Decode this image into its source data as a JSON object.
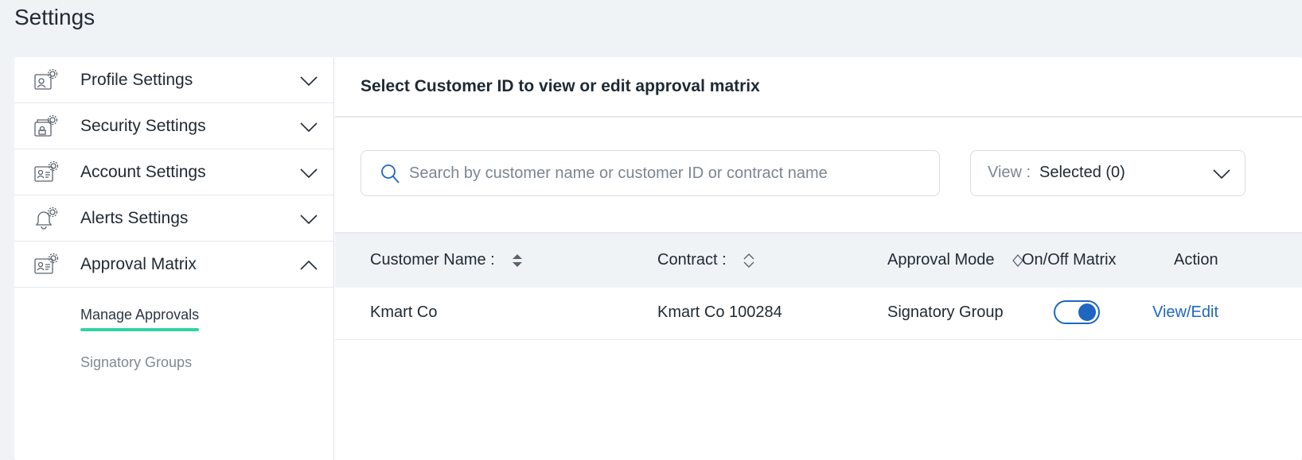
{
  "page": {
    "title": "Settings"
  },
  "sidebar": {
    "items": [
      {
        "label": "Profile Settings",
        "icon": "profile-settings-icon",
        "expanded": false
      },
      {
        "label": "Security Settings",
        "icon": "security-settings-icon",
        "expanded": false
      },
      {
        "label": "Account Settings",
        "icon": "account-settings-icon",
        "expanded": false
      },
      {
        "label": "Alerts Settings",
        "icon": "alerts-settings-icon",
        "expanded": false
      },
      {
        "label": "Approval Matrix",
        "icon": "approval-matrix-icon",
        "expanded": true
      }
    ],
    "submenu": {
      "active": "Manage Approvals",
      "inactive": "Signatory Groups"
    }
  },
  "main": {
    "heading": "Select Customer ID to view or edit approval matrix",
    "search": {
      "placeholder": "Search by customer name or customer ID or contract name",
      "value": ""
    },
    "view_filter": {
      "label": "View :",
      "value": "Selected (0)"
    },
    "table": {
      "columns": [
        "Customer Name :",
        "Contract :",
        "Approval Mode",
        "On/Off Matrix",
        "Action"
      ],
      "rows": [
        {
          "customer_name": "Kmart Co",
          "contract": "Kmart Co 100284",
          "approval_mode": "Signatory Group",
          "matrix_on": true,
          "action": "View/Edit"
        }
      ]
    }
  },
  "colors": {
    "accent": "#1f66c1",
    "active_underline": "#2ed3a5",
    "background": "#f0f3f6"
  }
}
